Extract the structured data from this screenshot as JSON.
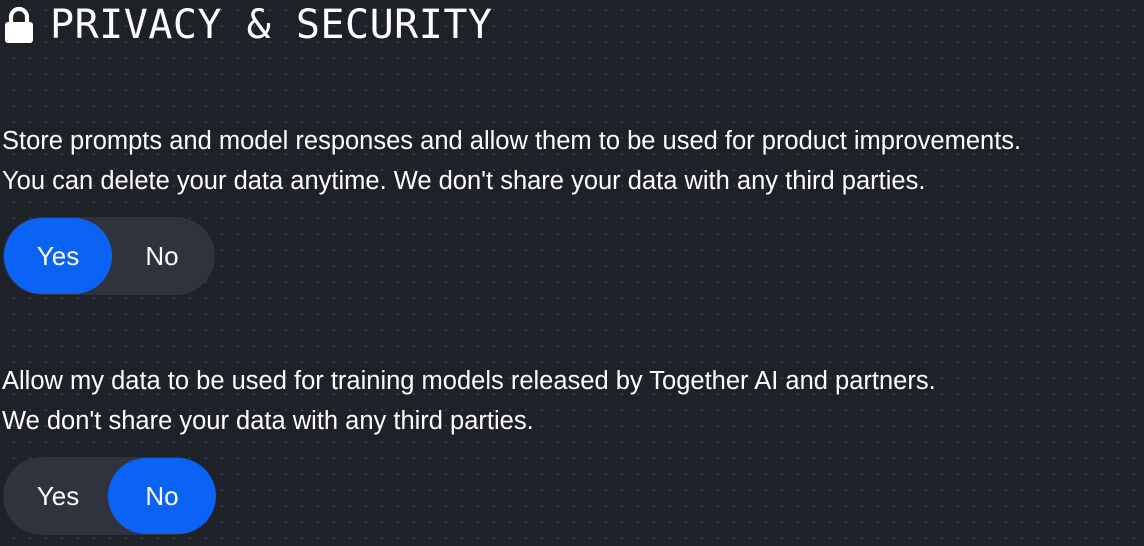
{
  "header": {
    "title": "PRIVACY & SECURITY",
    "icon": "lock-icon"
  },
  "settings": [
    {
      "description_lines": [
        "Store prompts and model responses and allow them to be used for product improvements.",
        "You can delete your data anytime. We don't share your data with any third parties."
      ],
      "options": [
        "Yes",
        "No"
      ],
      "selected": "Yes"
    },
    {
      "description_lines": [
        "Allow my data to be used for training models released by Together AI and partners.",
        "We don't share your data with any third parties."
      ],
      "options": [
        "Yes",
        "No"
      ],
      "selected": "No"
    }
  ],
  "colors": {
    "background": "#1f2128",
    "toggle_track": "#30333d",
    "accent": "#0a63f5",
    "text": "#ffffff"
  }
}
